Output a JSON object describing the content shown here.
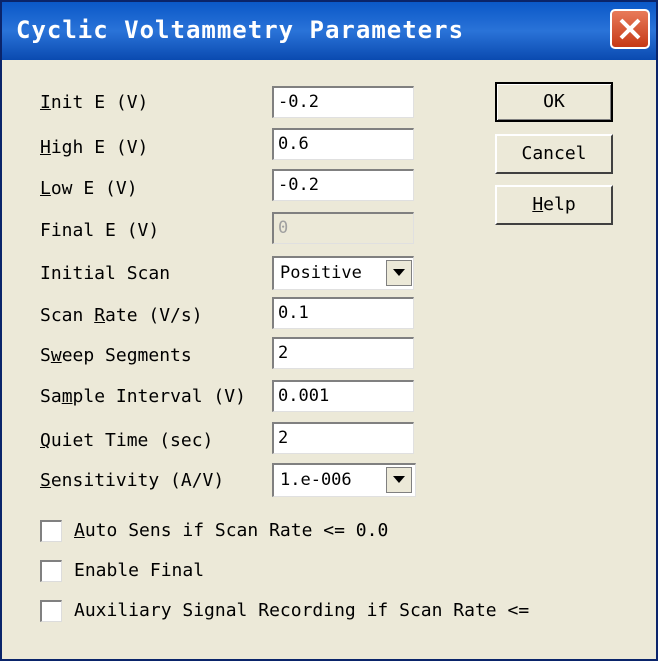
{
  "window": {
    "title": "Cyclic Voltammetry Parameters"
  },
  "params": [
    {
      "label_u": "I",
      "label_rest": "nit E (V)",
      "value": "-0.2"
    },
    {
      "label_u": "H",
      "label_rest": "igh E (V)",
      "value": "0.6"
    },
    {
      "label_u": "L",
      "label_rest": "ow E (V)",
      "value": "-0.2"
    },
    {
      "label_pre": "Final E (V)",
      "value": "0",
      "disabled": true
    },
    {
      "label_pre": "Initial Scan",
      "value": "Positive"
    },
    {
      "label_pre": "Scan ",
      "label_u": "R",
      "label_rest": "ate (V/s)",
      "value": "0.1"
    },
    {
      "label_pre": "S",
      "label_u": "w",
      "label_rest": "eep Segments",
      "value": "2"
    },
    {
      "label_pre": "Sa",
      "label_u": "m",
      "label_rest": "ple Interval (V)",
      "value": "0.001"
    },
    {
      "label_u": "Q",
      "label_rest": "uiet Time (sec)",
      "value": "2"
    },
    {
      "label_u": "S",
      "label_rest": "ensitivity (A/V)",
      "value": "1.e-006"
    }
  ],
  "buttons": {
    "ok": "OK",
    "cancel": "Cancel",
    "help_u": "H",
    "help_rest": "elp"
  },
  "checkboxes": [
    {
      "label_u": "A",
      "label_rest": "uto Sens if Scan Rate <= 0.0",
      "checked": false
    },
    {
      "label_u": "",
      "label_rest": "Enable Final",
      "checked": false
    },
    {
      "label_u": "",
      "label_rest": "Auxiliary Signal Recording if Scan Rate <=",
      "checked": false
    }
  ]
}
